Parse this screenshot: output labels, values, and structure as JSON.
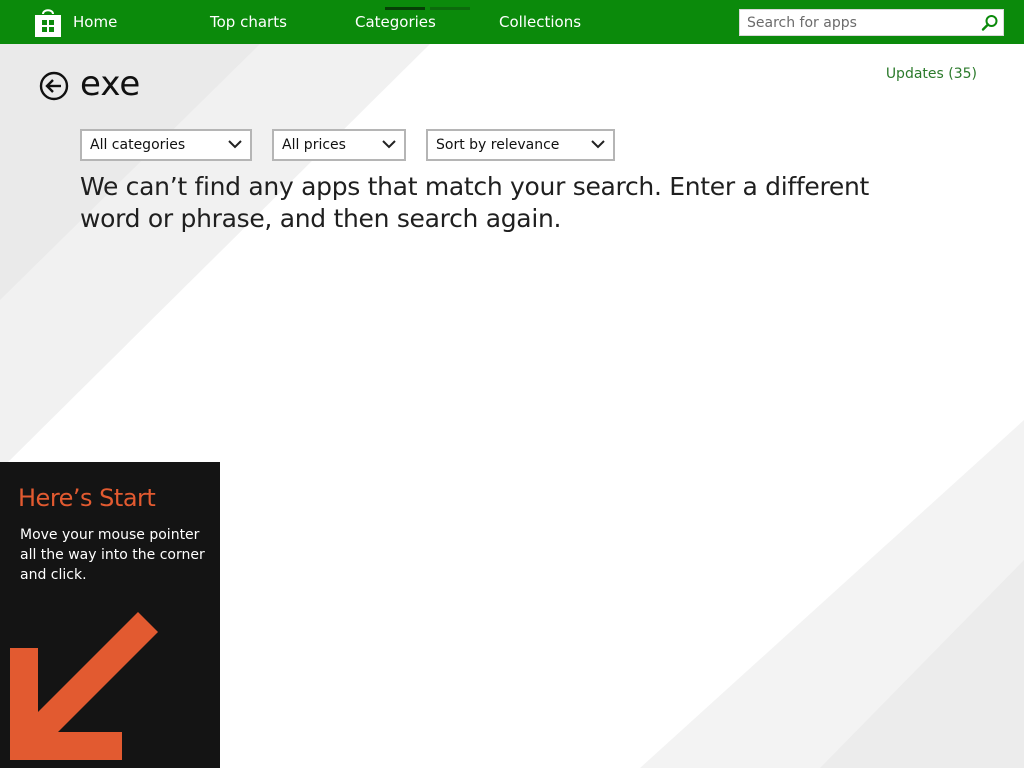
{
  "nav": {
    "home": "Home",
    "top_charts": "Top charts",
    "categories": "Categories",
    "collections": "Collections"
  },
  "search": {
    "placeholder": "Search for apps"
  },
  "page": {
    "title": "exe",
    "updates": "Updates (35)"
  },
  "filters": {
    "category": "All categories",
    "price": "All prices",
    "sort": "Sort by relevance"
  },
  "message": "We can’t find any apps that match your search. Enter a different word or phrase, and then search again.",
  "start_tip": {
    "title": "Here’s Start",
    "text": "Move your mouse pointer all the way into the corner and click."
  },
  "colors": {
    "brand_green": "#0b8a0b",
    "tip_accent": "#e25a30",
    "tip_background": "#141414"
  },
  "icons": [
    "store-bag-icon",
    "search-icon",
    "back-arrow-icon",
    "chevron-down-icon",
    "corner-arrow-icon"
  ]
}
